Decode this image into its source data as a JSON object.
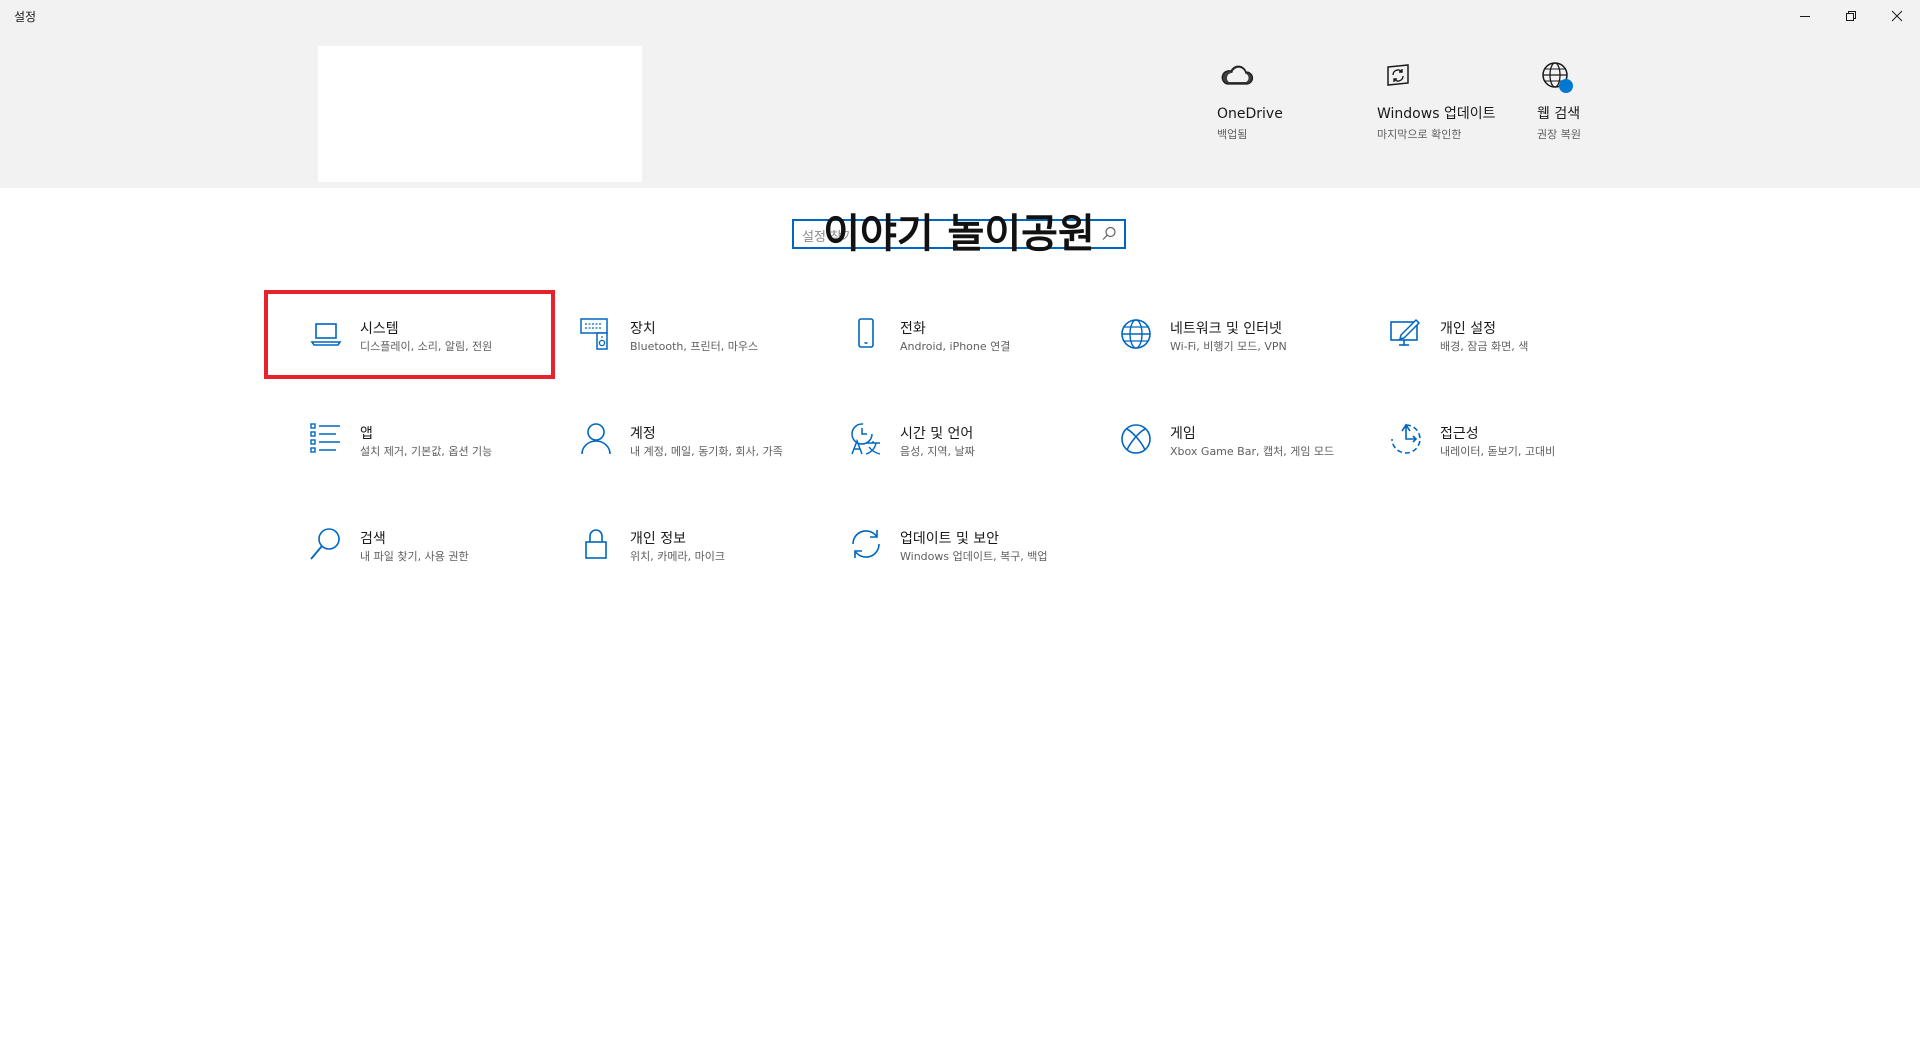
{
  "window": {
    "title": "설정",
    "minimize_label": "—",
    "maximize_label": "❐",
    "close_label": "✕"
  },
  "header": {
    "quick_links": [
      {
        "icon": "cloud-icon",
        "title": "OneDrive",
        "subtitle": "백업됨"
      },
      {
        "icon": "windows-update-icon",
        "title": "Windows 업데이트",
        "subtitle": "마지막으로 확인한"
      },
      {
        "icon": "web-search-icon",
        "title": "웹 검색",
        "subtitle": "권장 복원"
      }
    ]
  },
  "search": {
    "placeholder": "설정 찾기",
    "overlay_text": "이야기 놀이공원"
  },
  "settings": [
    {
      "icon": "laptop-icon",
      "title": "시스템",
      "description": "디스플레이, 소리, 알림, 전원"
    },
    {
      "icon": "devices-icon",
      "title": "장치",
      "description": "Bluetooth, 프린터, 마우스"
    },
    {
      "icon": "phone-icon",
      "title": "전화",
      "description": "Android, iPhone 연결"
    },
    {
      "icon": "globe-icon",
      "title": "네트워크 및 인터넷",
      "description": "Wi-Fi, 비행기 모드, VPN"
    },
    {
      "icon": "personalization-icon",
      "title": "개인 설정",
      "description": "배경, 잠금 화면, 색"
    },
    {
      "icon": "apps-list-icon",
      "title": "앱",
      "description": "설치 제거, 기본값, 옵션 기능"
    },
    {
      "icon": "person-icon",
      "title": "계정",
      "description": "내 계정, 메일, 동기화, 회사, 가족"
    },
    {
      "icon": "time-language-icon",
      "title": "시간 및 언어",
      "description": "음성, 지역, 날짜"
    },
    {
      "icon": "xbox-icon",
      "title": "게임",
      "description": "Xbox Game Bar, 캡처, 게임 모드"
    },
    {
      "icon": "accessibility-icon",
      "title": "접근성",
      "description": "내레이터, 돋보기, 고대비"
    },
    {
      "icon": "search-icon",
      "title": "검색",
      "description": "내 파일 찾기, 사용 권한"
    },
    {
      "icon": "lock-icon",
      "title": "개인 정보",
      "description": "위치, 카메라, 마이크"
    },
    {
      "icon": "update-sync-icon",
      "title": "업데이트 및 보안",
      "description": "Windows 업데이트, 복구, 백업"
    }
  ],
  "colors": {
    "accent": "#0067c0",
    "highlight": "#e8222b",
    "header_bg": "#f2f2f2",
    "badge": "#0078d4"
  }
}
